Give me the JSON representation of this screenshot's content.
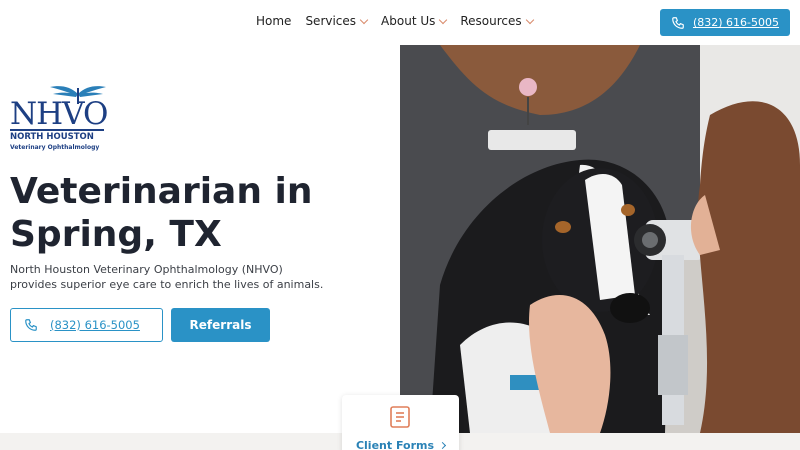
{
  "nav": {
    "items": [
      {
        "label": "Home",
        "has_dropdown": false
      },
      {
        "label": "Services",
        "has_dropdown": true
      },
      {
        "label": "About Us",
        "has_dropdown": true
      },
      {
        "label": "Resources",
        "has_dropdown": true
      }
    ],
    "call_label": "(832) 616-5005"
  },
  "logo": {
    "letters": "NHVO",
    "line1": "NORTH HOUSTON",
    "line2": "Veterinary Ophthalmology"
  },
  "hero": {
    "title": "Veterinarian in Spring, TX",
    "description": "North Houston Veterinary Ophthalmology (NHVO) provides superior eye care to enrich the lives of animals.",
    "phone_button": "(832) 616-5005",
    "referrals_button": "Referrals"
  },
  "card": {
    "label": "Client Forms"
  },
  "colors": {
    "accent": "#2a92c6",
    "brand_navy": "#1d3f83",
    "chevron": "#d98a6a"
  },
  "icons": {
    "phone": "phone-icon",
    "forms": "clipboard-icon",
    "dropdown": "chevron-down-icon"
  }
}
